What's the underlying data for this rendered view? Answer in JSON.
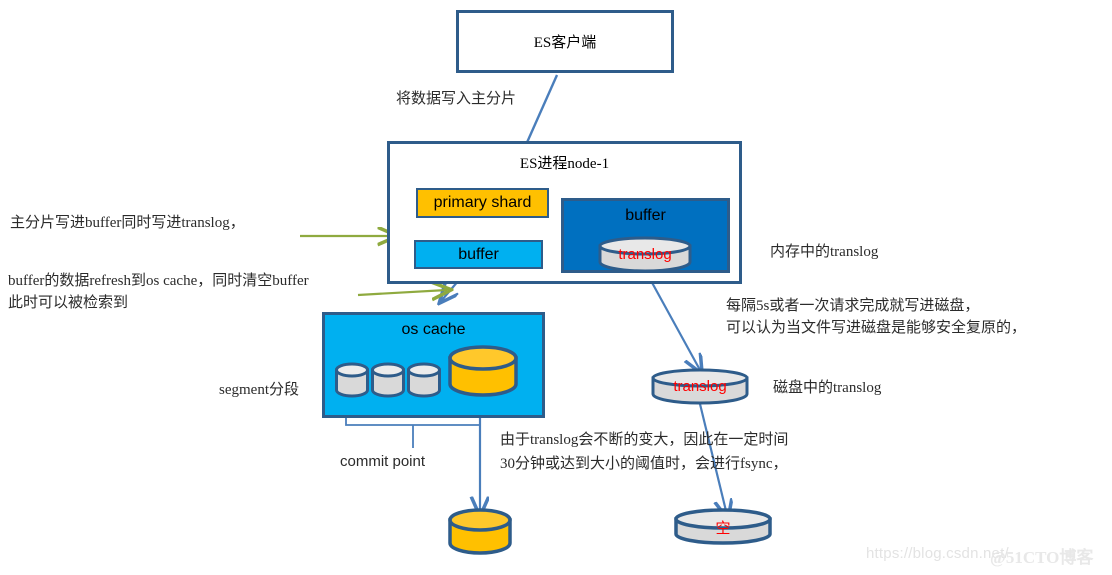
{
  "diagram": {
    "title_note": "Elasticsearch write path diagram",
    "nodes": {
      "es_client": "ES客户端",
      "es_process": "ES进程node-1",
      "primary_shard": "primary shard",
      "buffer_light": "buffer",
      "buffer_dark": "buffer",
      "translog_memory": "translog",
      "translog_disk": "translog",
      "os_cache": "os cache",
      "empty_disk": "空"
    },
    "annotations": {
      "write_to_primary": "将数据写入主分片",
      "primary_write_buffer_translog": "主分片写进buffer同时写进translog，",
      "refresh_line1": "buffer的数据refresh到os cache，同时清空buffer",
      "refresh_line2": "此时可以被检索到",
      "memory_translog": "内存中的translog",
      "fsync_line1": "每隔5s或者一次请求完成就写进磁盘，",
      "fsync_line2": "可以认为当文件写进磁盘是能够安全复原的，",
      "disk_translog": "磁盘中的translog",
      "segment_label": "segment分段",
      "commit_point": "commit point",
      "translog_grow_line1": "由于translog会不断的变大，因此在一定时间",
      "translog_grow_line2": "30分钟或达到大小的阈值时，会进行fsync，"
    },
    "watermark": {
      "url": "https://blog.csdn.net/",
      "brand": "@51CTO博客"
    },
    "colors": {
      "border_blue": "#2e5c8a",
      "primary_shard_fill": "#ffc000",
      "buffer_light_fill": "#00b0f0",
      "buffer_dark_fill": "#0070c0",
      "cylinder_gray": "#d9d9d9",
      "cylinder_gold": "#ffc000",
      "arrow_blue": "#4a7ebb",
      "arrow_green": "#8faa3f",
      "translog_red": "#ff0000",
      "segment_arrow_purple": "#8f7fae"
    }
  }
}
